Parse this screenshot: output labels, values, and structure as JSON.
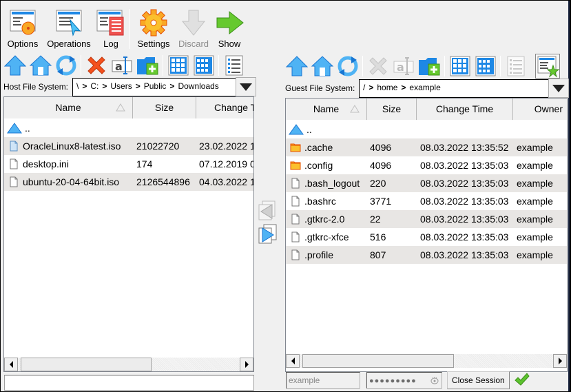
{
  "toolbar": {
    "options_label": "Options",
    "operations_label": "Operations",
    "log_label": "Log",
    "settings_label": "Settings",
    "discard_label": "Discard",
    "show_label": "Show"
  },
  "host": {
    "label": "Host File System:",
    "path": [
      "\\",
      "C:",
      "Users",
      "Public",
      "Downloads"
    ],
    "path_display": {
      "p0": "\\",
      "p1": "C:",
      "p2": "Users",
      "p3": "Public",
      "p4": "Downloads"
    },
    "separator": ">",
    "columns": [
      "Name",
      "Size",
      "Change Time"
    ],
    "up_label": "..",
    "files": [
      {
        "name": "OracleLinux8-latest.iso",
        "size": "21022720",
        "time": "23.02.2022 1",
        "icon": "file-icon-selected"
      },
      {
        "name": "desktop.ini",
        "size": "174",
        "time": "07.12.2019 0",
        "icon": "file-icon"
      },
      {
        "name": "ubuntu-20-04-64bit.iso",
        "size": "2126544896",
        "time": "04.03.2022 1",
        "icon": "file-icon"
      }
    ],
    "status_text": ""
  },
  "guest": {
    "label": "Guest File System:",
    "path_display": {
      "p0": "/",
      "p1": "home",
      "p2": "example"
    },
    "separator": ">",
    "columns": [
      "Name",
      "Size",
      "Change Time",
      "Owner"
    ],
    "up_label": "..",
    "files": [
      {
        "name": ".cache",
        "size": "4096",
        "time": "08.03.2022 13:35:52",
        "owner": "example",
        "icon": "folder-icon"
      },
      {
        "name": ".config",
        "size": "4096",
        "time": "08.03.2022 13:35:03",
        "owner": "example",
        "icon": "folder-icon"
      },
      {
        "name": ".bash_logout",
        "size": "220",
        "time": "08.03.2022 13:35:03",
        "owner": "example",
        "icon": "file-icon"
      },
      {
        "name": ".bashrc",
        "size": "3771",
        "time": "08.03.2022 13:35:03",
        "owner": "example",
        "icon": "file-icon"
      },
      {
        "name": ".gtkrc-2.0",
        "size": "22",
        "time": "08.03.2022 13:35:03",
        "owner": "example",
        "icon": "file-icon"
      },
      {
        "name": ".gtkrc-xfce",
        "size": "516",
        "time": "08.03.2022 13:35:03",
        "owner": "example",
        "icon": "file-icon"
      },
      {
        "name": ".profile",
        "size": "807",
        "time": "08.03.2022 13:35:03",
        "owner": "example",
        "icon": "file-icon"
      }
    ]
  },
  "session": {
    "username_placeholder": "example",
    "password_mask": "●●●●●●●●●",
    "close_label": "Close Session"
  },
  "colors": {
    "accent_blue": "#1e90ff",
    "row_alt": "#e8e6e4",
    "ok_green": "#5cc22e"
  }
}
